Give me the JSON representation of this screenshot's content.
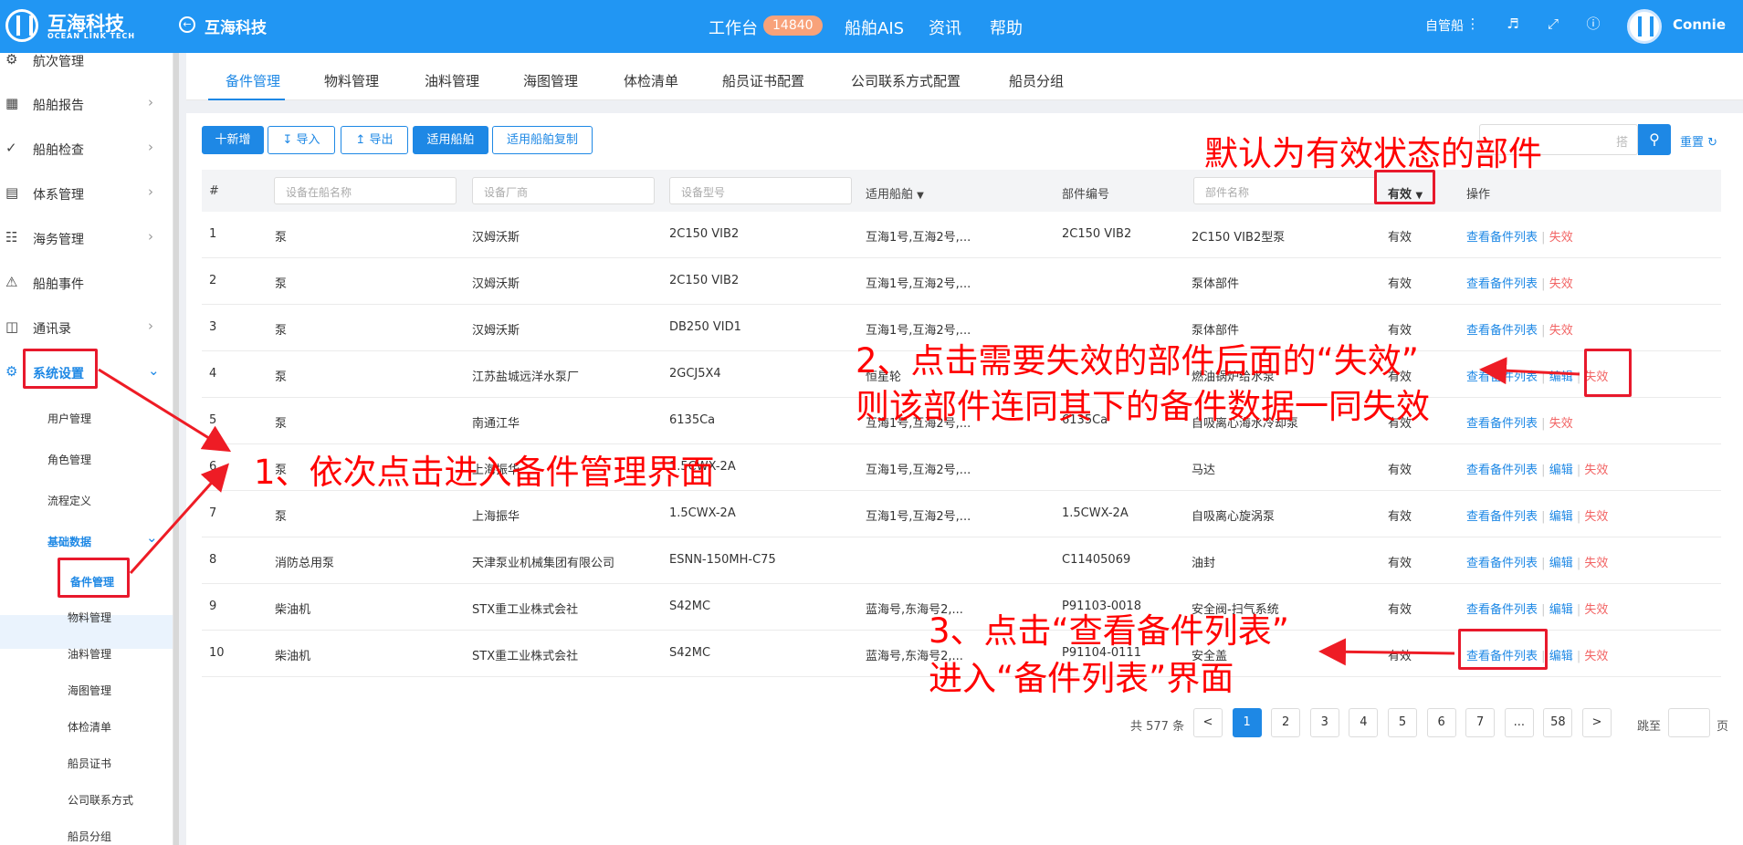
{
  "header": {
    "brand_cn": "互海科技",
    "brand_en": "OCEAN LINK TECH",
    "page_title": "互海科技",
    "nav_workbench": "工作台",
    "workbench_count": "14840",
    "nav_ais": "船舶AIS",
    "nav_news": "资讯",
    "nav_help": "帮助",
    "ship_select": "自管船",
    "user_name": "Connie",
    "accent_color": "#2196f3"
  },
  "sidebar": {
    "items": [
      {
        "label": "航次管理",
        "icon": "globe-icon"
      },
      {
        "label": "船舶报告",
        "icon": "calendar-icon"
      },
      {
        "label": "船舶检查",
        "icon": "check-circle-icon"
      },
      {
        "label": "体系管理",
        "icon": "document-icon"
      },
      {
        "label": "海务管理",
        "icon": "structure-icon"
      },
      {
        "label": "船舶事件",
        "icon": "warning-icon"
      },
      {
        "label": "通讯录",
        "icon": "contacts-icon"
      },
      {
        "label": "系统设置",
        "icon": "gear-icon"
      }
    ],
    "system_sub": [
      "用户管理",
      "角色管理",
      "流程定义"
    ],
    "basic_data": "基础数据",
    "basic_sub": [
      "备件管理",
      "物料管理",
      "油料管理",
      "海图管理",
      "体检清单",
      "船员证书",
      "公司联系方式",
      "船员分组"
    ]
  },
  "tabs": [
    "备件管理",
    "物料管理",
    "油料管理",
    "海图管理",
    "体检清单",
    "船员证书配置",
    "公司联系方式配置",
    "船员分组"
  ],
  "toolbar": {
    "add": "十新增",
    "import": "导入",
    "export": "导出",
    "applicable": "适用船舶",
    "copy": "适用船舶复制",
    "search_placeholder": "搭",
    "reset": "重置"
  },
  "table": {
    "headers": {
      "index": "#",
      "ship_equipment": "设备在船名称",
      "manufacturer": "设备厂商",
      "model": "设备型号",
      "ships": "适用船舶",
      "part_no": "部件编号",
      "part_name": "部件名称",
      "status": "有效",
      "ops": "操作"
    },
    "op_view": "查看备件列表",
    "op_edit": "编辑",
    "op_disable": "失效",
    "rows": [
      {
        "no": "1",
        "equip": "泵",
        "maker": "汉姆沃斯",
        "model": "2C150 VIB2",
        "ships": "互海1号,互海2号,...",
        "part_no": "2C150 VIB2",
        "part_name": "2C150 VIB2型泵",
        "status": "有效",
        "edit": false
      },
      {
        "no": "2",
        "equip": "泵",
        "maker": "汉姆沃斯",
        "model": "2C150 VIB2",
        "ships": "互海1号,互海2号,...",
        "part_no": "",
        "part_name": "泵体部件",
        "status": "有效",
        "edit": false
      },
      {
        "no": "3",
        "equip": "泵",
        "maker": "汉姆沃斯",
        "model": "DB250 VID1",
        "ships": "互海1号,互海2号,...",
        "part_no": "",
        "part_name": "泵体部件",
        "status": "有效",
        "edit": false
      },
      {
        "no": "4",
        "equip": "泵",
        "maker": "江苏盐城远洋水泵厂",
        "model": "2GCJ5X4",
        "ships": "恒星轮",
        "part_no": "",
        "part_name": "燃油锅炉给水泵",
        "status": "有效",
        "edit": true
      },
      {
        "no": "5",
        "equip": "泵",
        "maker": "南通江华",
        "model": "6135Ca",
        "ships": "互海1号,互海2号,...",
        "part_no": "6135Ca",
        "part_name": "自吸离心海水冷却泵",
        "status": "有效",
        "edit": false
      },
      {
        "no": "6",
        "equip": "泵",
        "maker": "上海振华",
        "model": "1.5CWX-2A",
        "ships": "互海1号,互海2号,...",
        "part_no": "",
        "part_name": "马达",
        "status": "有效",
        "edit": true
      },
      {
        "no": "7",
        "equip": "泵",
        "maker": "上海振华",
        "model": "1.5CWX-2A",
        "ships": "互海1号,互海2号,...",
        "part_no": "1.5CWX-2A",
        "part_name": "自吸离心旋涡泵",
        "status": "有效",
        "edit": true
      },
      {
        "no": "8",
        "equip": "消防总用泵",
        "maker": "天津泵业机械集团有限公司",
        "model": "ESNN-150MH-C75",
        "ships": "",
        "part_no": "C11405069",
        "part_name": "油封",
        "status": "有效",
        "edit": true
      },
      {
        "no": "9",
        "equip": "柴油机",
        "maker": "STX重工业株式会社",
        "model": "S42MC",
        "ships": "蓝海号,东海号2,...",
        "part_no": "P91103-0018",
        "part_name": "安全阀-扫气系统",
        "status": "有效",
        "edit": true
      },
      {
        "no": "10",
        "equip": "柴油机",
        "maker": "STX重工业株式会社",
        "model": "S42MC",
        "ships": "蓝海号,东海号2,...",
        "part_no": "P91104-0111",
        "part_name": "安全盖",
        "status": "有效",
        "edit": true
      }
    ]
  },
  "pagination": {
    "total": "共 577 条",
    "prev": "<",
    "next": ">",
    "pages": [
      "1",
      "2",
      "3",
      "4",
      "5",
      "6",
      "7",
      "...",
      "58"
    ],
    "current": "1",
    "goto": "跳至",
    "page_unit": "页"
  },
  "annotations": {
    "a0": "默认为有效状态的部件",
    "a1": "1、依次点击进入备件管理界面",
    "a2_line1": "2、点击需要失效的部件后面的“失效”",
    "a2_line2": "则该部件连同其下的备件数据一同失效",
    "a3_line1": "3、点击“查看备件列表”",
    "a3_line2": "进入“备件列表”界面",
    "color": "#ff0000"
  }
}
